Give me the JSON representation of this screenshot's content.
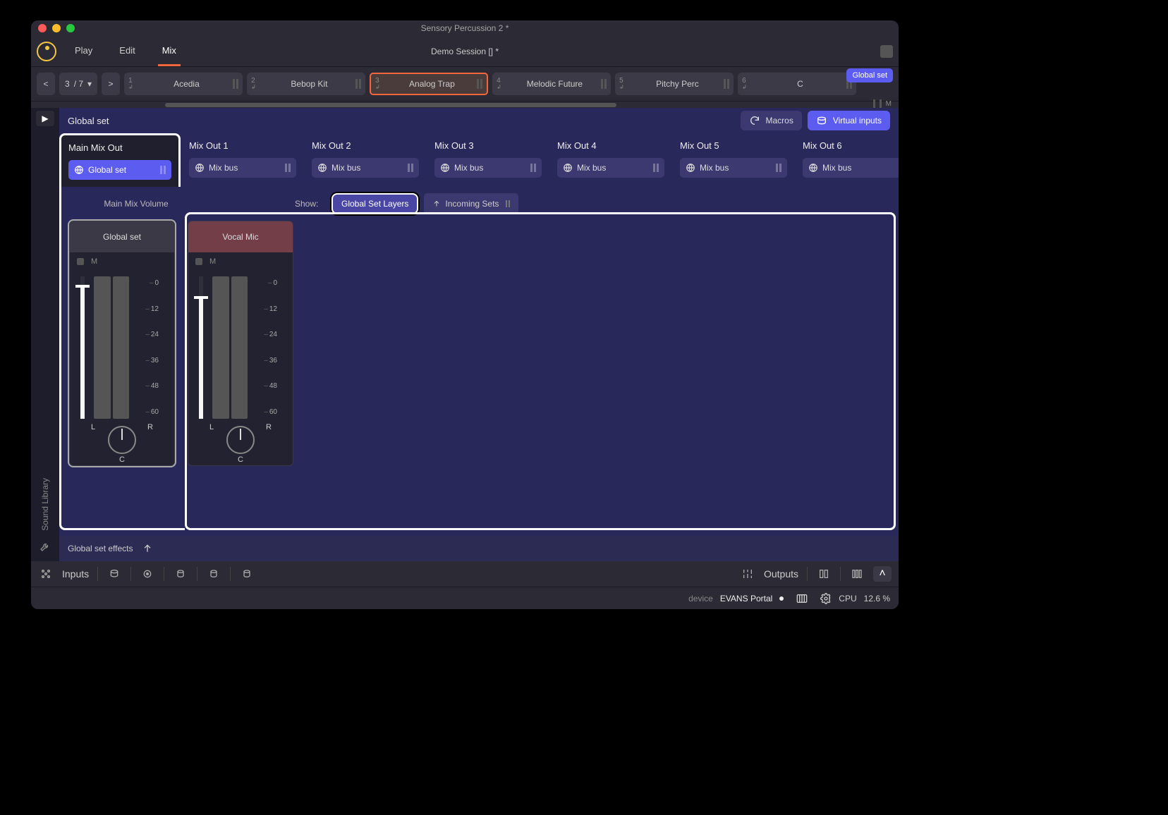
{
  "window": {
    "title": "Sensory Percussion 2 *"
  },
  "menu": {
    "tabs": [
      "Play",
      "Edit",
      "Mix"
    ],
    "active": 2,
    "session": "Demo Session  [] *"
  },
  "kitbar": {
    "page": "3",
    "total": "/ 7",
    "slots": [
      {
        "num": "1",
        "name": "Acedia"
      },
      {
        "num": "2",
        "name": "Bebop Kit"
      },
      {
        "num": "3",
        "name": "Analog Trap",
        "active": true
      },
      {
        "num": "4",
        "name": "Melodic Future"
      },
      {
        "num": "5",
        "name": "Pitchy Perc"
      },
      {
        "num": "6",
        "name": "C"
      }
    ],
    "badge": "Global set",
    "mute_mini": "M"
  },
  "side": {
    "library": "Sound Library"
  },
  "panel": {
    "title": "Global set",
    "macros": "Macros",
    "virtual": "Virtual inputs",
    "mixvol": "Main Mix Volume",
    "show": "Show:",
    "show_layers": "Global Set Layers",
    "show_incoming": "Incoming Sets"
  },
  "outs": [
    {
      "title": "Main Mix Out",
      "bus": "Global set",
      "active": true
    },
    {
      "title": "Mix Out 1",
      "bus": "Mix bus"
    },
    {
      "title": "Mix Out 2",
      "bus": "Mix bus"
    },
    {
      "title": "Mix Out 3",
      "bus": "Mix bus"
    },
    {
      "title": "Mix Out 4",
      "bus": "Mix bus"
    },
    {
      "title": "Mix Out 5",
      "bus": "Mix bus"
    },
    {
      "title": "Mix Out 6",
      "bus": "Mix bus"
    }
  ],
  "strips": [
    {
      "name": "Global set",
      "mute": "M",
      "scale": [
        "0",
        "12",
        "24",
        "36",
        "48",
        "60"
      ],
      "L": "L",
      "R": "R",
      "C": "C",
      "fill": 94,
      "handle": 6
    },
    {
      "name": "Vocal Mic",
      "mute": "M",
      "scale": [
        "0",
        "12",
        "24",
        "36",
        "48",
        "60"
      ],
      "L": "L",
      "R": "R",
      "C": "C",
      "fill": 86,
      "handle": 14,
      "vocal": true
    }
  ],
  "fx": {
    "label": "Global set effects"
  },
  "footer": {
    "inputs": "Inputs",
    "outputs": "Outputs"
  },
  "status": {
    "device": "device",
    "name": "EVANS Portal",
    "cpu_label": "CPU",
    "cpu_val": "12.6 %"
  }
}
